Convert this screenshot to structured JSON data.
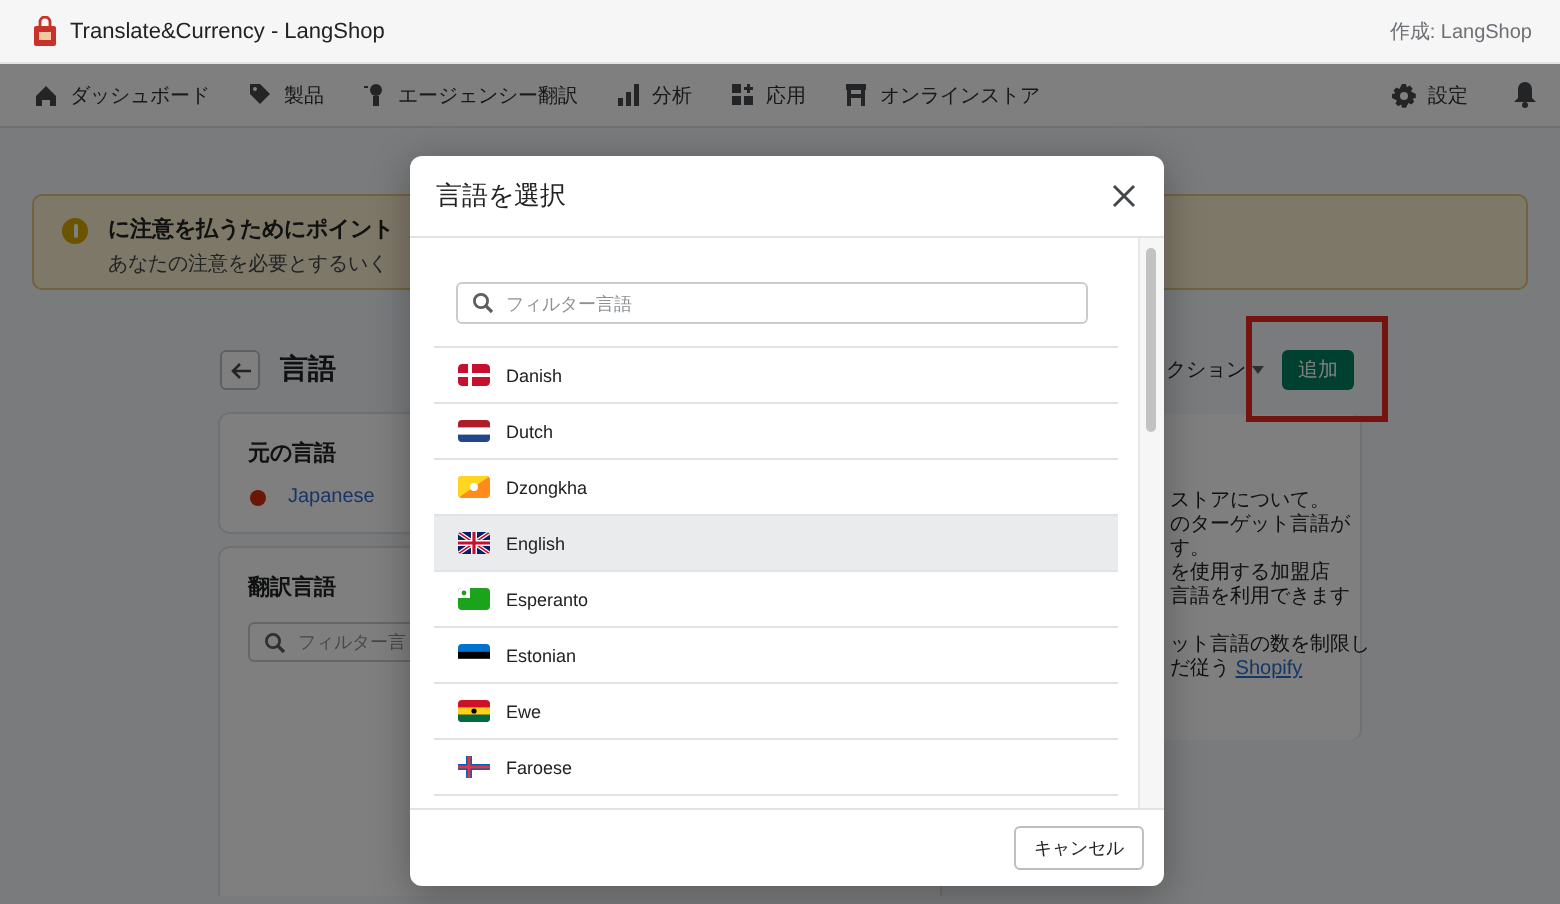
{
  "app_bar": {
    "title": "Translate&Currency - LangShop",
    "author": "作成: LangShop"
  },
  "nav": {
    "items": [
      {
        "label": "ダッシュボード",
        "kind": "home"
      },
      {
        "label": "製品",
        "kind": "tag"
      },
      {
        "label": "エージェンシー翻訳",
        "kind": "agent"
      },
      {
        "label": "分析",
        "kind": "chart"
      },
      {
        "label": "応用",
        "kind": "apps"
      },
      {
        "label": "オンラインストア",
        "kind": "store"
      }
    ],
    "settings": "設定"
  },
  "banner": {
    "title": "に注意を払うためにポイント",
    "text": "あなたの注意を必要とするいく"
  },
  "page": {
    "title": "言語",
    "source_card": {
      "title": "元の言語",
      "language": "Japanese"
    },
    "target_card": {
      "title": "翻訳言語",
      "placeholder": "フィルター言"
    },
    "actions_label": "クション",
    "add_button": "追加",
    "info_lines": [
      "ストアについて。",
      "のターゲット言語が",
      "す。",
      "を使用する加盟店",
      "言語を利用できます",
      "ット言語の数を制限し"
    ],
    "info_last": {
      "text": "だ従う",
      "link": "Shopify"
    }
  },
  "modal": {
    "title": "言語を選択",
    "placeholder": "フィルター言語",
    "languages": [
      {
        "name": "Danish",
        "selected": false
      },
      {
        "name": "Dutch",
        "selected": false
      },
      {
        "name": "Dzongkha",
        "selected": false
      },
      {
        "name": "English",
        "selected": true
      },
      {
        "name": "Esperanto",
        "selected": false
      },
      {
        "name": "Estonian",
        "selected": false
      },
      {
        "name": "Ewe",
        "selected": false
      },
      {
        "name": "Faroese",
        "selected": false
      }
    ],
    "cancel": "キャンセル"
  }
}
